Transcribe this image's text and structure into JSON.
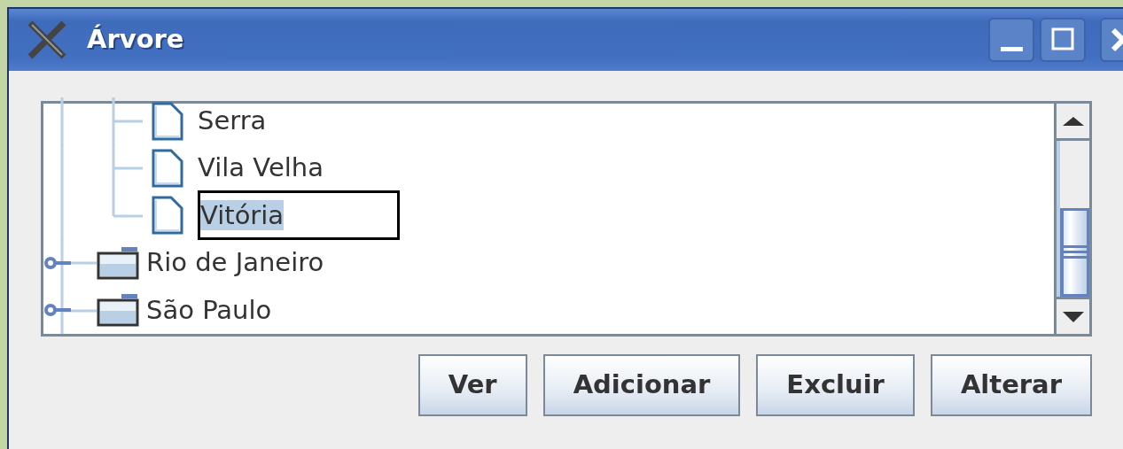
{
  "window": {
    "title": "Árvore"
  },
  "tree": {
    "items": [
      {
        "children": [
          {
            "kind": "leaf",
            "label": "Serra",
            "editing": false
          },
          {
            "kind": "leaf",
            "label": "Vila Velha",
            "editing": false
          },
          {
            "kind": "leaf",
            "label": "Vitória",
            "editing": true
          }
        ]
      },
      {
        "kind": "folder",
        "label": "Rio de Janeiro",
        "expanded": false
      },
      {
        "kind": "folder",
        "label": "São Paulo",
        "expanded": false
      }
    ]
  },
  "buttons": [
    "Ver",
    "Adicionar",
    "Excluir",
    "Alterar"
  ]
}
